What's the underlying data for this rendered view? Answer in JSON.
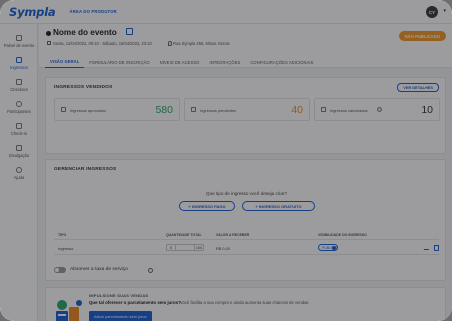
{
  "app": {
    "logo": "Sympla",
    "area_label": "ÁREA DO PRODUTOR",
    "avatar_initials": "CY"
  },
  "sidebar": {
    "items": [
      {
        "label": "Painel de evento",
        "icon": "dashboard-icon"
      },
      {
        "label": "Ingressos",
        "icon": "ticket-icon"
      },
      {
        "label": "Checkout",
        "icon": "cart-icon"
      },
      {
        "label": "Participantes",
        "icon": "people-icon"
      },
      {
        "label": "Check-in",
        "icon": "checkin-icon"
      },
      {
        "label": "Divulgação",
        "icon": "megaphone-icon"
      },
      {
        "label": "Ajuda",
        "icon": "help-icon"
      }
    ]
  },
  "event": {
    "title": "Nome do evento",
    "date": "Sexta, 12/04/2022, 09:10 - Sábado, 15/04/2022, 23:10",
    "location": "Rua Sympla 456, Minas Gerais",
    "status": "NÃO PUBLICADO"
  },
  "tabs": [
    {
      "label": "VISÃO GERAL",
      "active": true
    },
    {
      "label": "FORMULÁRIO DE INSCRIÇÃO",
      "active": false
    },
    {
      "label": "NÍVEIS DE ACESSO",
      "active": false
    },
    {
      "label": "INTEGRAÇÕES",
      "active": false
    },
    {
      "label": "CONFIGURAÇÕES ADICIONAIS",
      "active": false
    }
  ],
  "sold": {
    "title": "INGRESSOS VENDIDOS",
    "details_button": "VER DETALHES",
    "stats": [
      {
        "label": "Ingressos aprovados",
        "value": "580",
        "color": "#2aa66b"
      },
      {
        "label": "Ingressos pendentes",
        "value": "40",
        "color": "#f08a24"
      },
      {
        "label": "Ingressos cancelados",
        "value": "10",
        "color": "#333333"
      }
    ]
  },
  "manage": {
    "title": "GERENCIAR INGRESSOS",
    "question": "Que tipo de ingresso você deseja criar?",
    "paid_button": "+ INGRESSO PAGO",
    "free_button": "+ INGRESSO GRATUITO",
    "columns": [
      "TIPO",
      "QUANTIDADE TOTAL",
      "VALOR A RECEBER",
      "VISIBILIDADE DO INGRESSO"
    ],
    "row": {
      "type": "Ingresso",
      "qty_value": "0",
      "qty_total": "100",
      "value": "R$ 0,00",
      "visibility": "PÚBLICO"
    },
    "fee_label": "Absorver a taxa de serviço"
  },
  "promo": {
    "kicker": "IMPULSIONE SUAS VENDAS",
    "question": "Que tal oferecer o parcelamento sem juros?",
    "text": "Você facilita a sua compra e ainda aumenta suas chances de vendas",
    "button": "Ativar parcelamento sem juros"
  },
  "colors": {
    "brand": "#1a5fd6",
    "status_orange": "#f19a2a"
  }
}
